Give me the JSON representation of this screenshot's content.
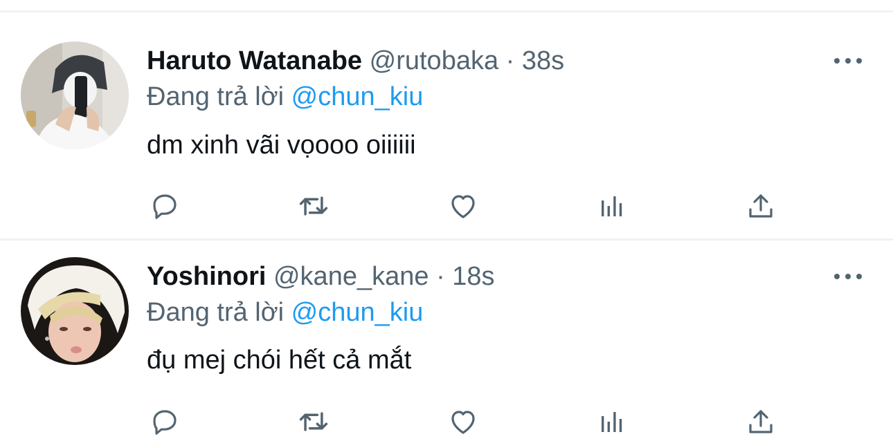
{
  "tweets": [
    {
      "name": "Haruto Watanabe",
      "handle": "@rutobaka",
      "separator": "·",
      "time": "38s",
      "reply_prefix": "Đang trả lời",
      "reply_to": "@chun_kiu",
      "text": "dm xinh vãi vọooo oiiiiii",
      "avatar": "profile-photo",
      "more_icon": "more-horizontal-icon",
      "actions": [
        "reply-icon",
        "retweet-icon",
        "like-icon",
        "analytics-icon",
        "share-icon"
      ]
    },
    {
      "name": "Yoshinori",
      "handle": "@kane_kane",
      "separator": "·",
      "time": "18s",
      "reply_prefix": "Đang trả lời",
      "reply_to": "@chun_kiu",
      "text": "đụ mej chói hết cả mắt",
      "avatar": "profile-photo",
      "more_icon": "more-horizontal-icon",
      "actions": [
        "reply-icon",
        "retweet-icon",
        "like-icon",
        "analytics-icon",
        "share-icon"
      ]
    }
  ],
  "colors": {
    "text": "#0f1419",
    "secondary": "#536471",
    "link": "#1d9bf0",
    "divider": "#eff3f4"
  }
}
